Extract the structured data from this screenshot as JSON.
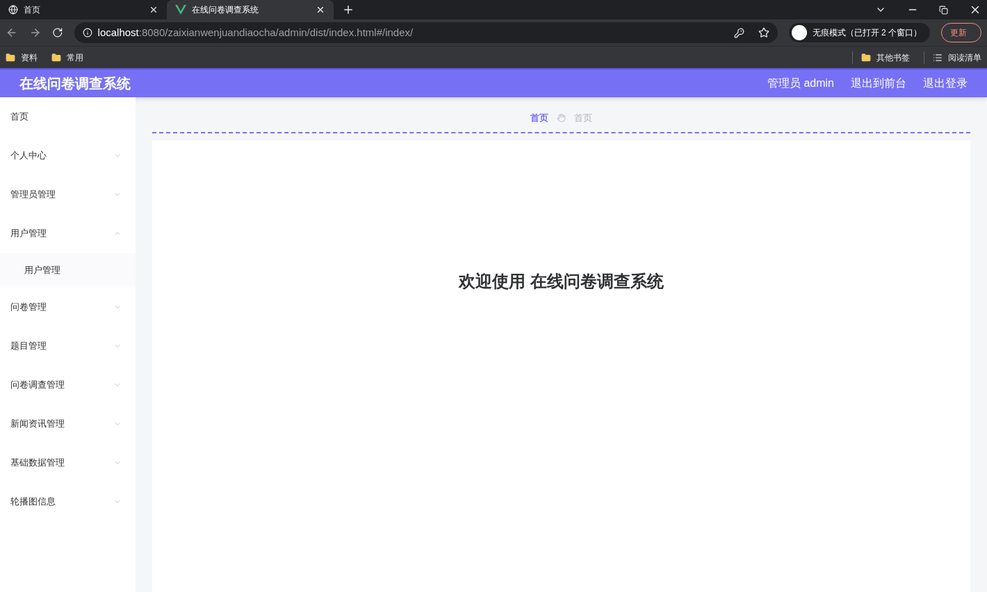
{
  "browser": {
    "tabs": [
      {
        "title": "首页",
        "selected": false
      },
      {
        "title": "在线问卷调查系统",
        "selected": true
      }
    ],
    "address": {
      "host": "localhost",
      "rest": ":8080/zaixianwenjuandiaocha/admin/dist/index.html#/index/"
    },
    "profile": "无痕模式（已打开 2 个窗口）",
    "update_button": "更新",
    "bookmarks": [
      {
        "label": "资料"
      },
      {
        "label": "常用"
      }
    ],
    "other_bookmarks": "其他书签",
    "reading_list": "阅读清单"
  },
  "app": {
    "title": "在线问卷调查系统",
    "header_links": [
      "管理员 admin",
      "退出到前台",
      "退出登录"
    ]
  },
  "sidebar": {
    "items": [
      {
        "label": "首页",
        "kind": "link"
      },
      {
        "label": "个人中心",
        "kind": "group",
        "expanded": false
      },
      {
        "label": "管理员管理",
        "kind": "group",
        "expanded": false
      },
      {
        "label": "用户管理",
        "kind": "group",
        "expanded": true,
        "children": [
          {
            "label": "用户管理"
          }
        ]
      },
      {
        "label": "问卷管理",
        "kind": "group",
        "expanded": false
      },
      {
        "label": "题目管理",
        "kind": "group",
        "expanded": false
      },
      {
        "label": "问卷调查管理",
        "kind": "group",
        "expanded": false
      },
      {
        "label": "新闻资讯管理",
        "kind": "group",
        "expanded": false
      },
      {
        "label": "基础数据管理",
        "kind": "group",
        "expanded": false
      },
      {
        "label": "轮播图信息",
        "kind": "group",
        "expanded": false
      }
    ]
  },
  "breadcrumb": [
    {
      "label": "首页"
    },
    {
      "label": "首页"
    }
  ],
  "welcome": "欢迎使用 在线问卷调查系统"
}
